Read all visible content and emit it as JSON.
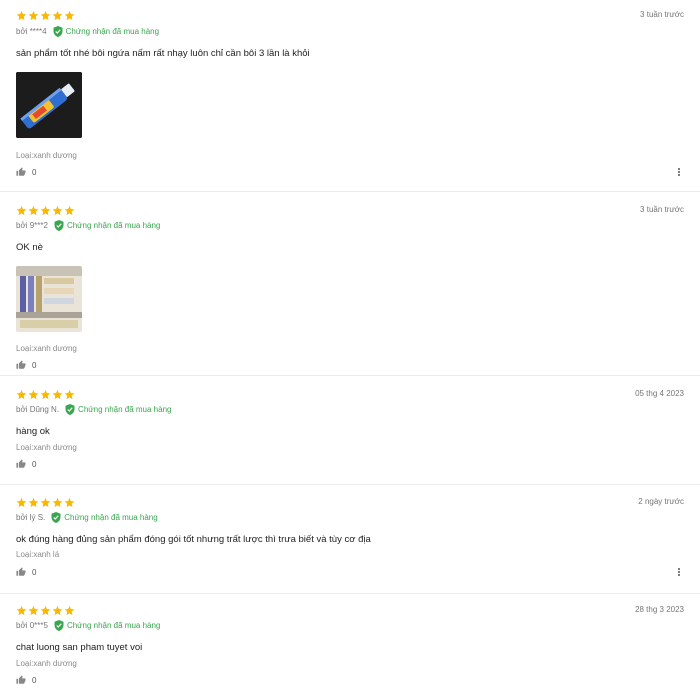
{
  "reviews": [
    {
      "rating": 5,
      "author": "bởi ****4",
      "verified_label": "Chứng nhận đã mua hàng",
      "date": "3 tuần trước",
      "content": "sản phẩm tốt nhé bôi ngứa nấm rất nhạy luôn chỉ cần bôi 3 lần là khỏi",
      "has_image": true,
      "variant": "Loại:xanh dương",
      "likes": "0"
    },
    {
      "rating": 5,
      "author": "bởi 9***2",
      "verified_label": "Chứng nhận đã mua hàng",
      "date": "3 tuần trước",
      "content": "OK nè",
      "has_image": true,
      "variant": "Loại:xanh dương",
      "likes": "0"
    },
    {
      "rating": 5,
      "author": "bởi Dũng N.",
      "verified_label": "Chứng nhận đã mua hàng",
      "date": "05 thg 4 2023",
      "content": "hàng ok",
      "has_image": false,
      "variant": "Loại:xanh dương",
      "likes": "0"
    },
    {
      "rating": 5,
      "author": "bởi lý S.",
      "verified_label": "Chứng nhận đã mua hàng",
      "date": "2 ngày trước",
      "content": "ok đúng hàng đủng sản phẩm đóng gói tốt nhưng trất lược thì trưa biết và tùy cơ địa",
      "has_image": false,
      "variant": "Loại:xanh lá",
      "likes": "0"
    },
    {
      "rating": 5,
      "author": "bởi 0***5",
      "verified_label": "Chứng nhận đã mua hàng",
      "date": "28 thg 3 2023",
      "content": "chat luong san pham tuyet voi",
      "has_image": false,
      "variant": "Loại:xanh dương",
      "likes": "0"
    }
  ],
  "colors": {
    "star": "#f6b800",
    "verified": "#3aa64f",
    "muted_text": "#757575"
  },
  "icons": {
    "star": "star-icon",
    "verified": "shield-check-icon",
    "like": "thumbs-up-icon",
    "more": "more-vertical-icon"
  }
}
